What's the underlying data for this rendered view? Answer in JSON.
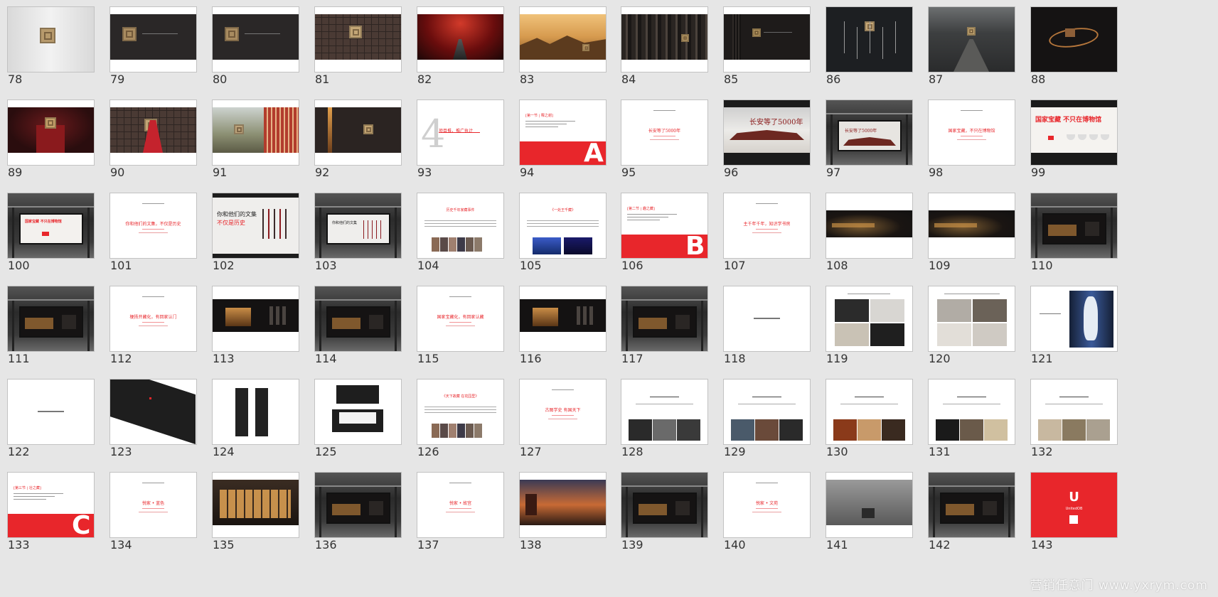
{
  "watermark": "营销任意门 www.yxrym.com",
  "colors": {
    "accent": "#e8262b",
    "dark": "#1c1a1a",
    "text": "#333333",
    "bg": "#e6e6e6"
  },
  "slides": [
    {
      "n": "78",
      "kind": "light-seal"
    },
    {
      "n": "79",
      "kind": "dark-seal"
    },
    {
      "n": "80",
      "kind": "dark-seal"
    },
    {
      "n": "81",
      "kind": "tiles"
    },
    {
      "n": "82",
      "kind": "red-path"
    },
    {
      "n": "83",
      "kind": "golden-landscape"
    },
    {
      "n": "84",
      "kind": "dark-pillars"
    },
    {
      "n": "85",
      "kind": "dark-gate"
    },
    {
      "n": "86",
      "kind": "dark-tools"
    },
    {
      "n": "87",
      "kind": "aerial-city"
    },
    {
      "n": "88",
      "kind": "dark-ring"
    },
    {
      "n": "89",
      "kind": "red-box"
    },
    {
      "n": "90",
      "kind": "tiles-figure"
    },
    {
      "n": "91",
      "kind": "city-building"
    },
    {
      "n": "92",
      "kind": "dark-door"
    },
    {
      "n": "93",
      "kind": "section-4",
      "big": "4",
      "title": "项目推，推广执计"
    },
    {
      "n": "94",
      "kind": "section-letter",
      "letter": "A",
      "heading": "[第一节 | 释之谢]"
    },
    {
      "n": "95",
      "kind": "red-title",
      "title": "长安等了5000年"
    },
    {
      "n": "96",
      "kind": "billboard-gray",
      "title": "长安等了5000年"
    },
    {
      "n": "97",
      "kind": "busstop-title",
      "title": "长安等了5000年"
    },
    {
      "n": "98",
      "kind": "red-title",
      "title": "国家宝藏，不只在博物馆"
    },
    {
      "n": "99",
      "kind": "billboard-red",
      "title": "国家宝藏 不只在博物馆"
    },
    {
      "n": "100",
      "kind": "busstop-red",
      "title": "国家宝藏 不只在博物馆"
    },
    {
      "n": "101",
      "kind": "red-title",
      "title": "你和他们的文集，不仅是历史"
    },
    {
      "n": "102",
      "kind": "dark-brushes",
      "title": "你和他们的文集",
      "title2": "不仅是历史"
    },
    {
      "n": "103",
      "kind": "busstop-brushes",
      "title": "你和他们的文集"
    },
    {
      "n": "104",
      "kind": "text-photos",
      "title": "历史千年家藏事件"
    },
    {
      "n": "105",
      "kind": "text-photos-blue",
      "title": "《一处王千藏》"
    },
    {
      "n": "106",
      "kind": "section-letter",
      "letter": "B",
      "heading": "[第二节 | 趣之藏]"
    },
    {
      "n": "107",
      "kind": "red-title",
      "title": "主千年千年，知识学书房"
    },
    {
      "n": "108",
      "kind": "dark-banner"
    },
    {
      "n": "109",
      "kind": "dark-banner"
    },
    {
      "n": "110",
      "kind": "busstop-dark"
    },
    {
      "n": "111",
      "kind": "busstop-dark"
    },
    {
      "n": "112",
      "kind": "red-title",
      "title": "梗扬开藏化，有回家认门"
    },
    {
      "n": "113",
      "kind": "dark-hall"
    },
    {
      "n": "114",
      "kind": "busstop-dark"
    },
    {
      "n": "115",
      "kind": "red-title",
      "title": "国家宝藏化，有回家认藏"
    },
    {
      "n": "116",
      "kind": "dark-hall"
    },
    {
      "n": "117",
      "kind": "busstop-dark"
    },
    {
      "n": "118",
      "kind": "small-text"
    },
    {
      "n": "119",
      "kind": "product-grid"
    },
    {
      "n": "120",
      "kind": "product-grid-light"
    },
    {
      "n": "121",
      "kind": "vase"
    },
    {
      "n": "122",
      "kind": "small-text"
    },
    {
      "n": "123",
      "kind": "black-box"
    },
    {
      "n": "124",
      "kind": "phones"
    },
    {
      "n": "125",
      "kind": "open-box"
    },
    {
      "n": "126",
      "kind": "text-photos",
      "title": "《天下故藏 在花园里》"
    },
    {
      "n": "127",
      "kind": "red-title",
      "title": "古图学史 有国天下"
    },
    {
      "n": "128",
      "kind": "quote-photos"
    },
    {
      "n": "129",
      "kind": "quote-photos"
    },
    {
      "n": "130",
      "kind": "quote-photos"
    },
    {
      "n": "131",
      "kind": "quote-photos"
    },
    {
      "n": "132",
      "kind": "quote-photos"
    },
    {
      "n": "133",
      "kind": "section-letter",
      "letter": "C",
      "heading": "[第三节 | 壮之藏]"
    },
    {
      "n": "134",
      "kind": "red-title",
      "title": "悦家 • 蓝色"
    },
    {
      "n": "135",
      "kind": "dark-building"
    },
    {
      "n": "136",
      "kind": "busstop-dark"
    },
    {
      "n": "137",
      "kind": "red-title",
      "title": "悦家 • 故宫"
    },
    {
      "n": "138",
      "kind": "dark-sunset"
    },
    {
      "n": "139",
      "kind": "busstop-dark"
    },
    {
      "n": "140",
      "kind": "red-title",
      "title": "悦家 • 文苑"
    },
    {
      "n": "141",
      "kind": "gray-interior"
    },
    {
      "n": "142",
      "kind": "busstop-dark"
    },
    {
      "n": "143",
      "kind": "red-logo",
      "logo": "U",
      "brand": "UnitedOB"
    }
  ]
}
